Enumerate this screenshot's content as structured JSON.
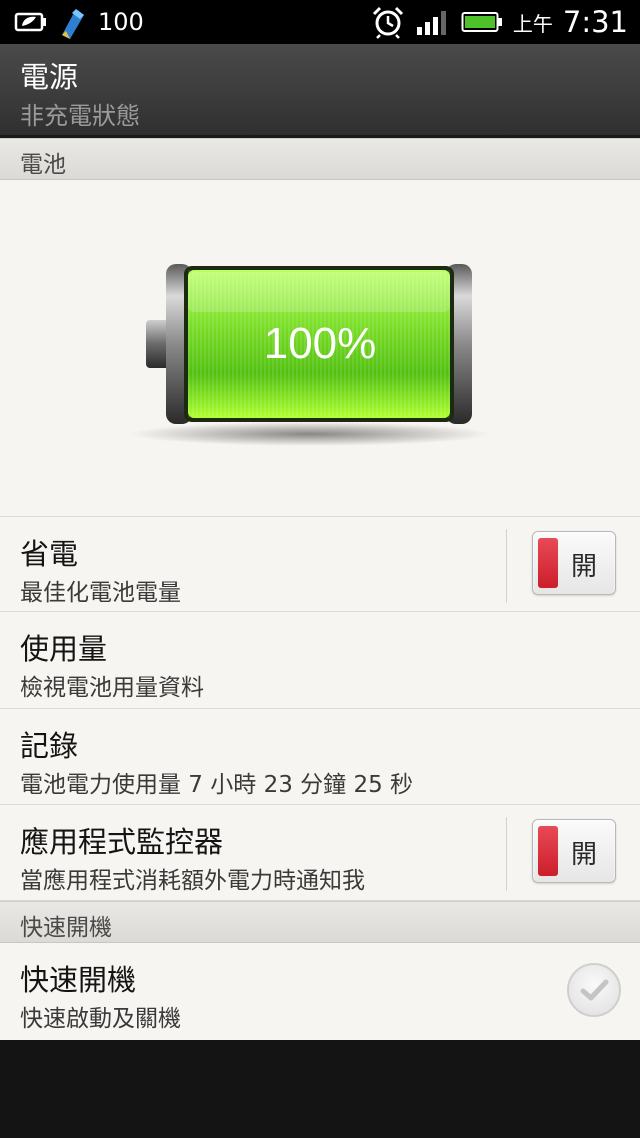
{
  "status_bar": {
    "battery_text": "100",
    "ampm": "上午",
    "time": "7:31",
    "icons": [
      "power-saver-icon",
      "sync-app-icon",
      "alarm-clock-icon",
      "signal-strength-icon",
      "battery-full-icon"
    ]
  },
  "header": {
    "title": "電源",
    "subtitle": "非充電狀態"
  },
  "battery_section": {
    "header": "電池",
    "level": 100,
    "level_text": "100%",
    "fill_color": "#7ee02a"
  },
  "settings": {
    "power_saver": {
      "title": "省電",
      "subtitle": "最佳化電池電量",
      "toggle_label": "開"
    },
    "usage": {
      "title": "使用量",
      "subtitle": "檢視電池用量資料"
    },
    "history": {
      "title": "記錄",
      "subtitle": "電池電力使用量 7 小時 23 分鐘 25 秒"
    },
    "app_monitor": {
      "title": "應用程式監控器",
      "subtitle": "當應用程式消耗額外電力時通知我",
      "toggle_label": "開"
    }
  },
  "fast_boot_section": {
    "header": "快速開機",
    "item": {
      "title": "快速開機",
      "subtitle": "快速啟動及關機",
      "checked": false
    }
  },
  "colors": {
    "toggle_accent": "#d8283a",
    "battery_green": "#7ee02a"
  }
}
